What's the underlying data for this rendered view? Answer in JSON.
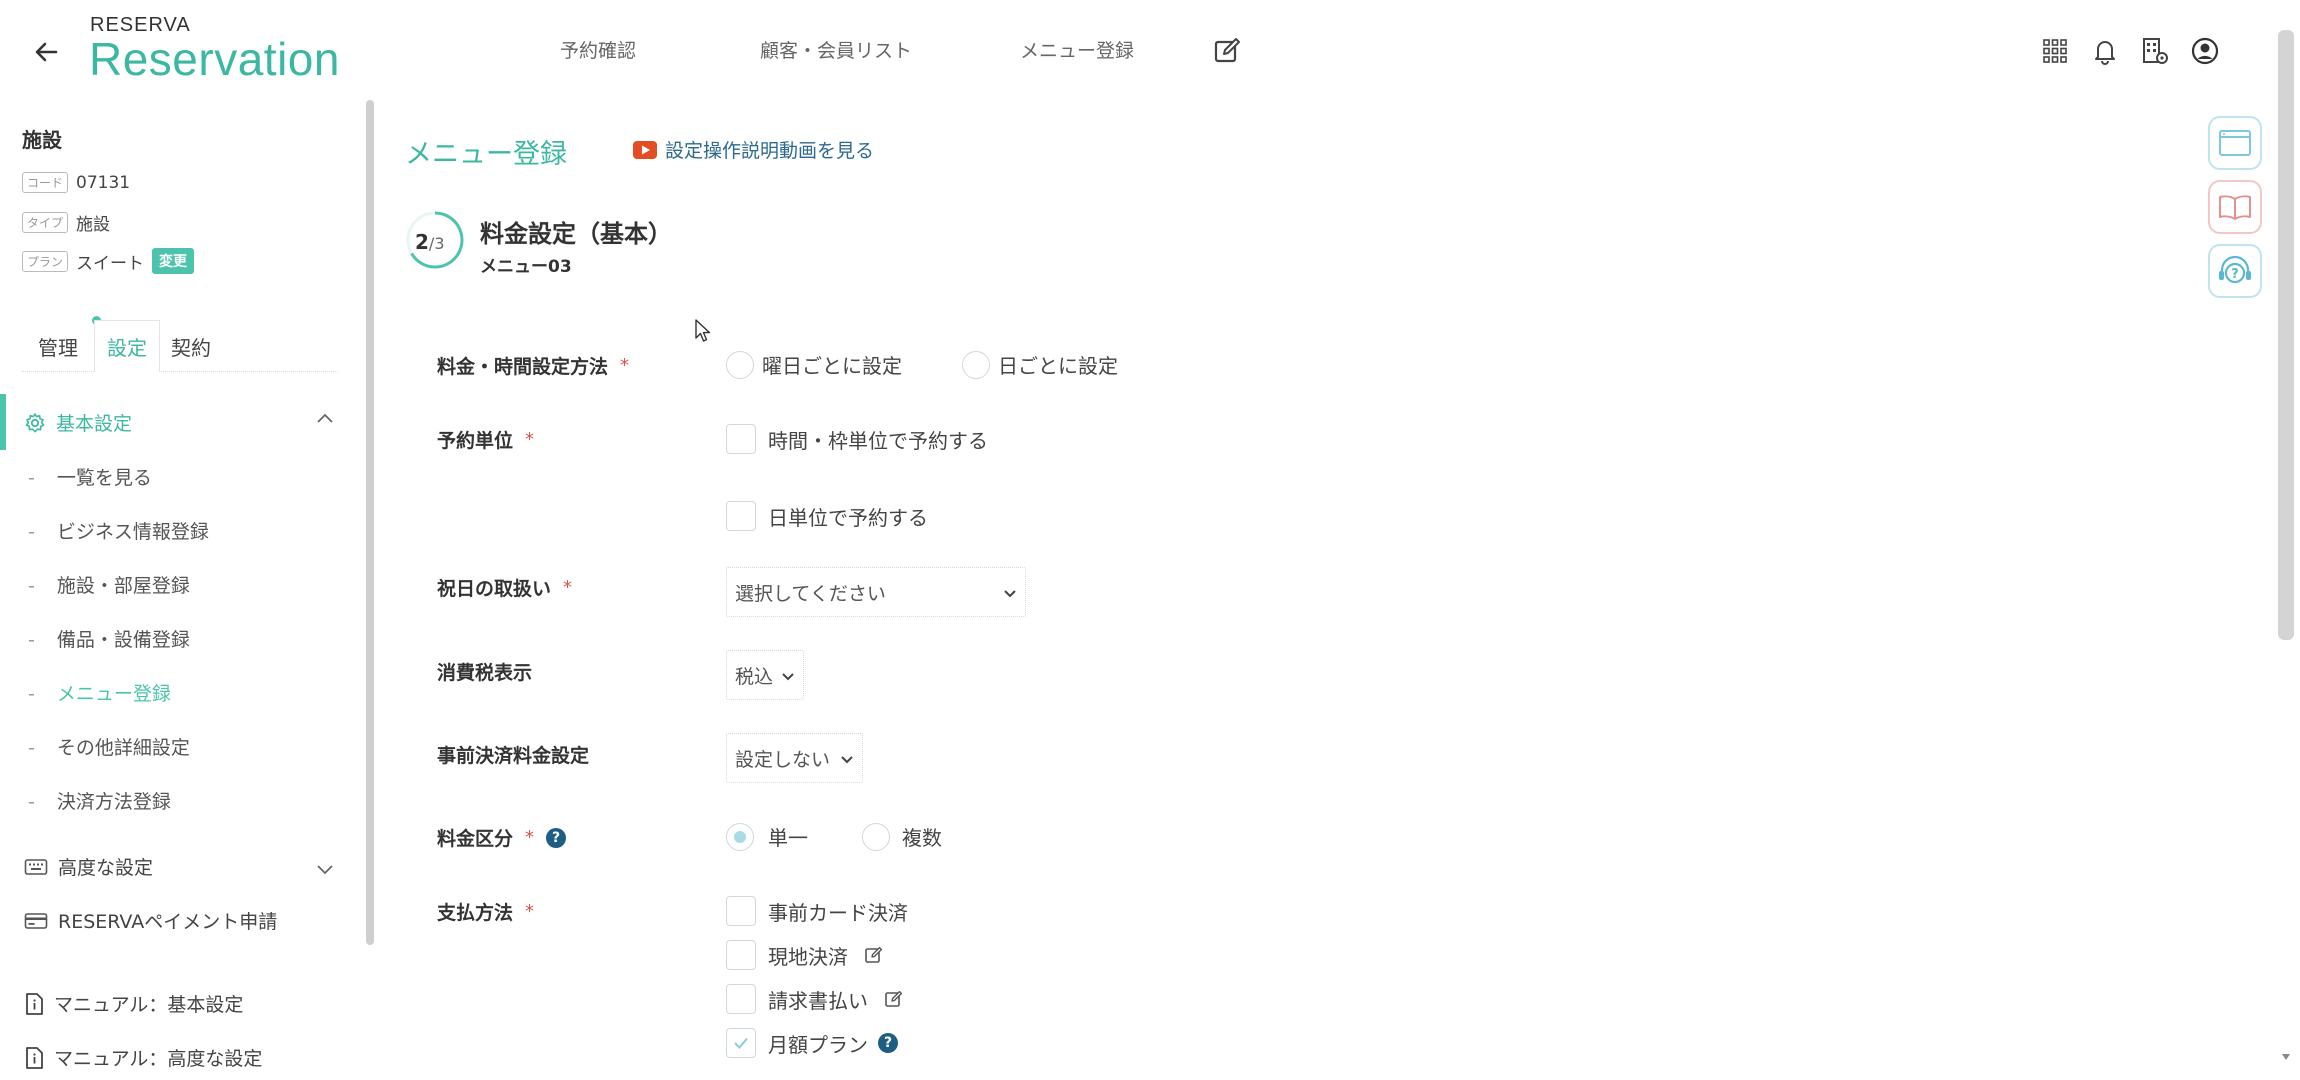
{
  "header": {
    "brand_small": "RESERVA",
    "brand_large": "Reservation",
    "nav": [
      "予約確認",
      "顧客・会員リスト",
      "メニュー登録"
    ]
  },
  "sidebar": {
    "facility_title": "施設",
    "code_tag": "コード",
    "code_value": "07131",
    "type_tag": "タイプ",
    "type_value": "施設",
    "plan_tag": "プラン",
    "plan_value": "スイート",
    "change_label": "変更",
    "tabs": [
      "管理",
      "設定",
      "契約"
    ],
    "active_tab": "設定",
    "basic_settings": "基本設定",
    "submenu": [
      "一覧を見る",
      "ビジネス情報登録",
      "施設・部屋登録",
      "備品・設備登録",
      "メニュー登録",
      "その他詳細設定",
      "決済方法登録"
    ],
    "active_submenu": "メニュー登録",
    "advanced_settings": "高度な設定",
    "payment_apply": "RESERVAペイメント申請",
    "manual_basic": "マニュアル：基本設定",
    "manual_advanced": "マニュアル：高度な設定"
  },
  "main": {
    "title": "メニュー登録",
    "video_link": "設定操作説明動画を見る",
    "step_current": "2",
    "step_total": "/3",
    "step_title": "料金設定（基本）",
    "step_subtitle": "メニュー03"
  },
  "form": {
    "required_mark": "*",
    "help_mark": "?",
    "price_method": {
      "label": "料金・時間設定方法",
      "options": [
        "曜日ごとに設定",
        "日ごとに設定"
      ]
    },
    "booking_unit": {
      "label": "予約単位",
      "options": [
        "時間・枠単位で予約する",
        "日単位で予約する"
      ]
    },
    "holiday": {
      "label": "祝日の取扱い",
      "value": "選択してください"
    },
    "tax": {
      "label": "消費税表示",
      "value": "税込"
    },
    "prepay": {
      "label": "事前決済料金設定",
      "value": "設定しない"
    },
    "price_type": {
      "label": "料金区分",
      "options": [
        "単一",
        "複数"
      ],
      "selected": "単一"
    },
    "payment": {
      "label": "支払方法",
      "options": [
        "事前カード決済",
        "現地決済",
        "請求書払い",
        "月額プラン"
      ],
      "checked": [
        "月額プラン"
      ]
    }
  },
  "colors": {
    "accent": "#3cb8a2",
    "link": "#2c6a8e",
    "required": "#d9534f",
    "help": "#1d5e82"
  }
}
